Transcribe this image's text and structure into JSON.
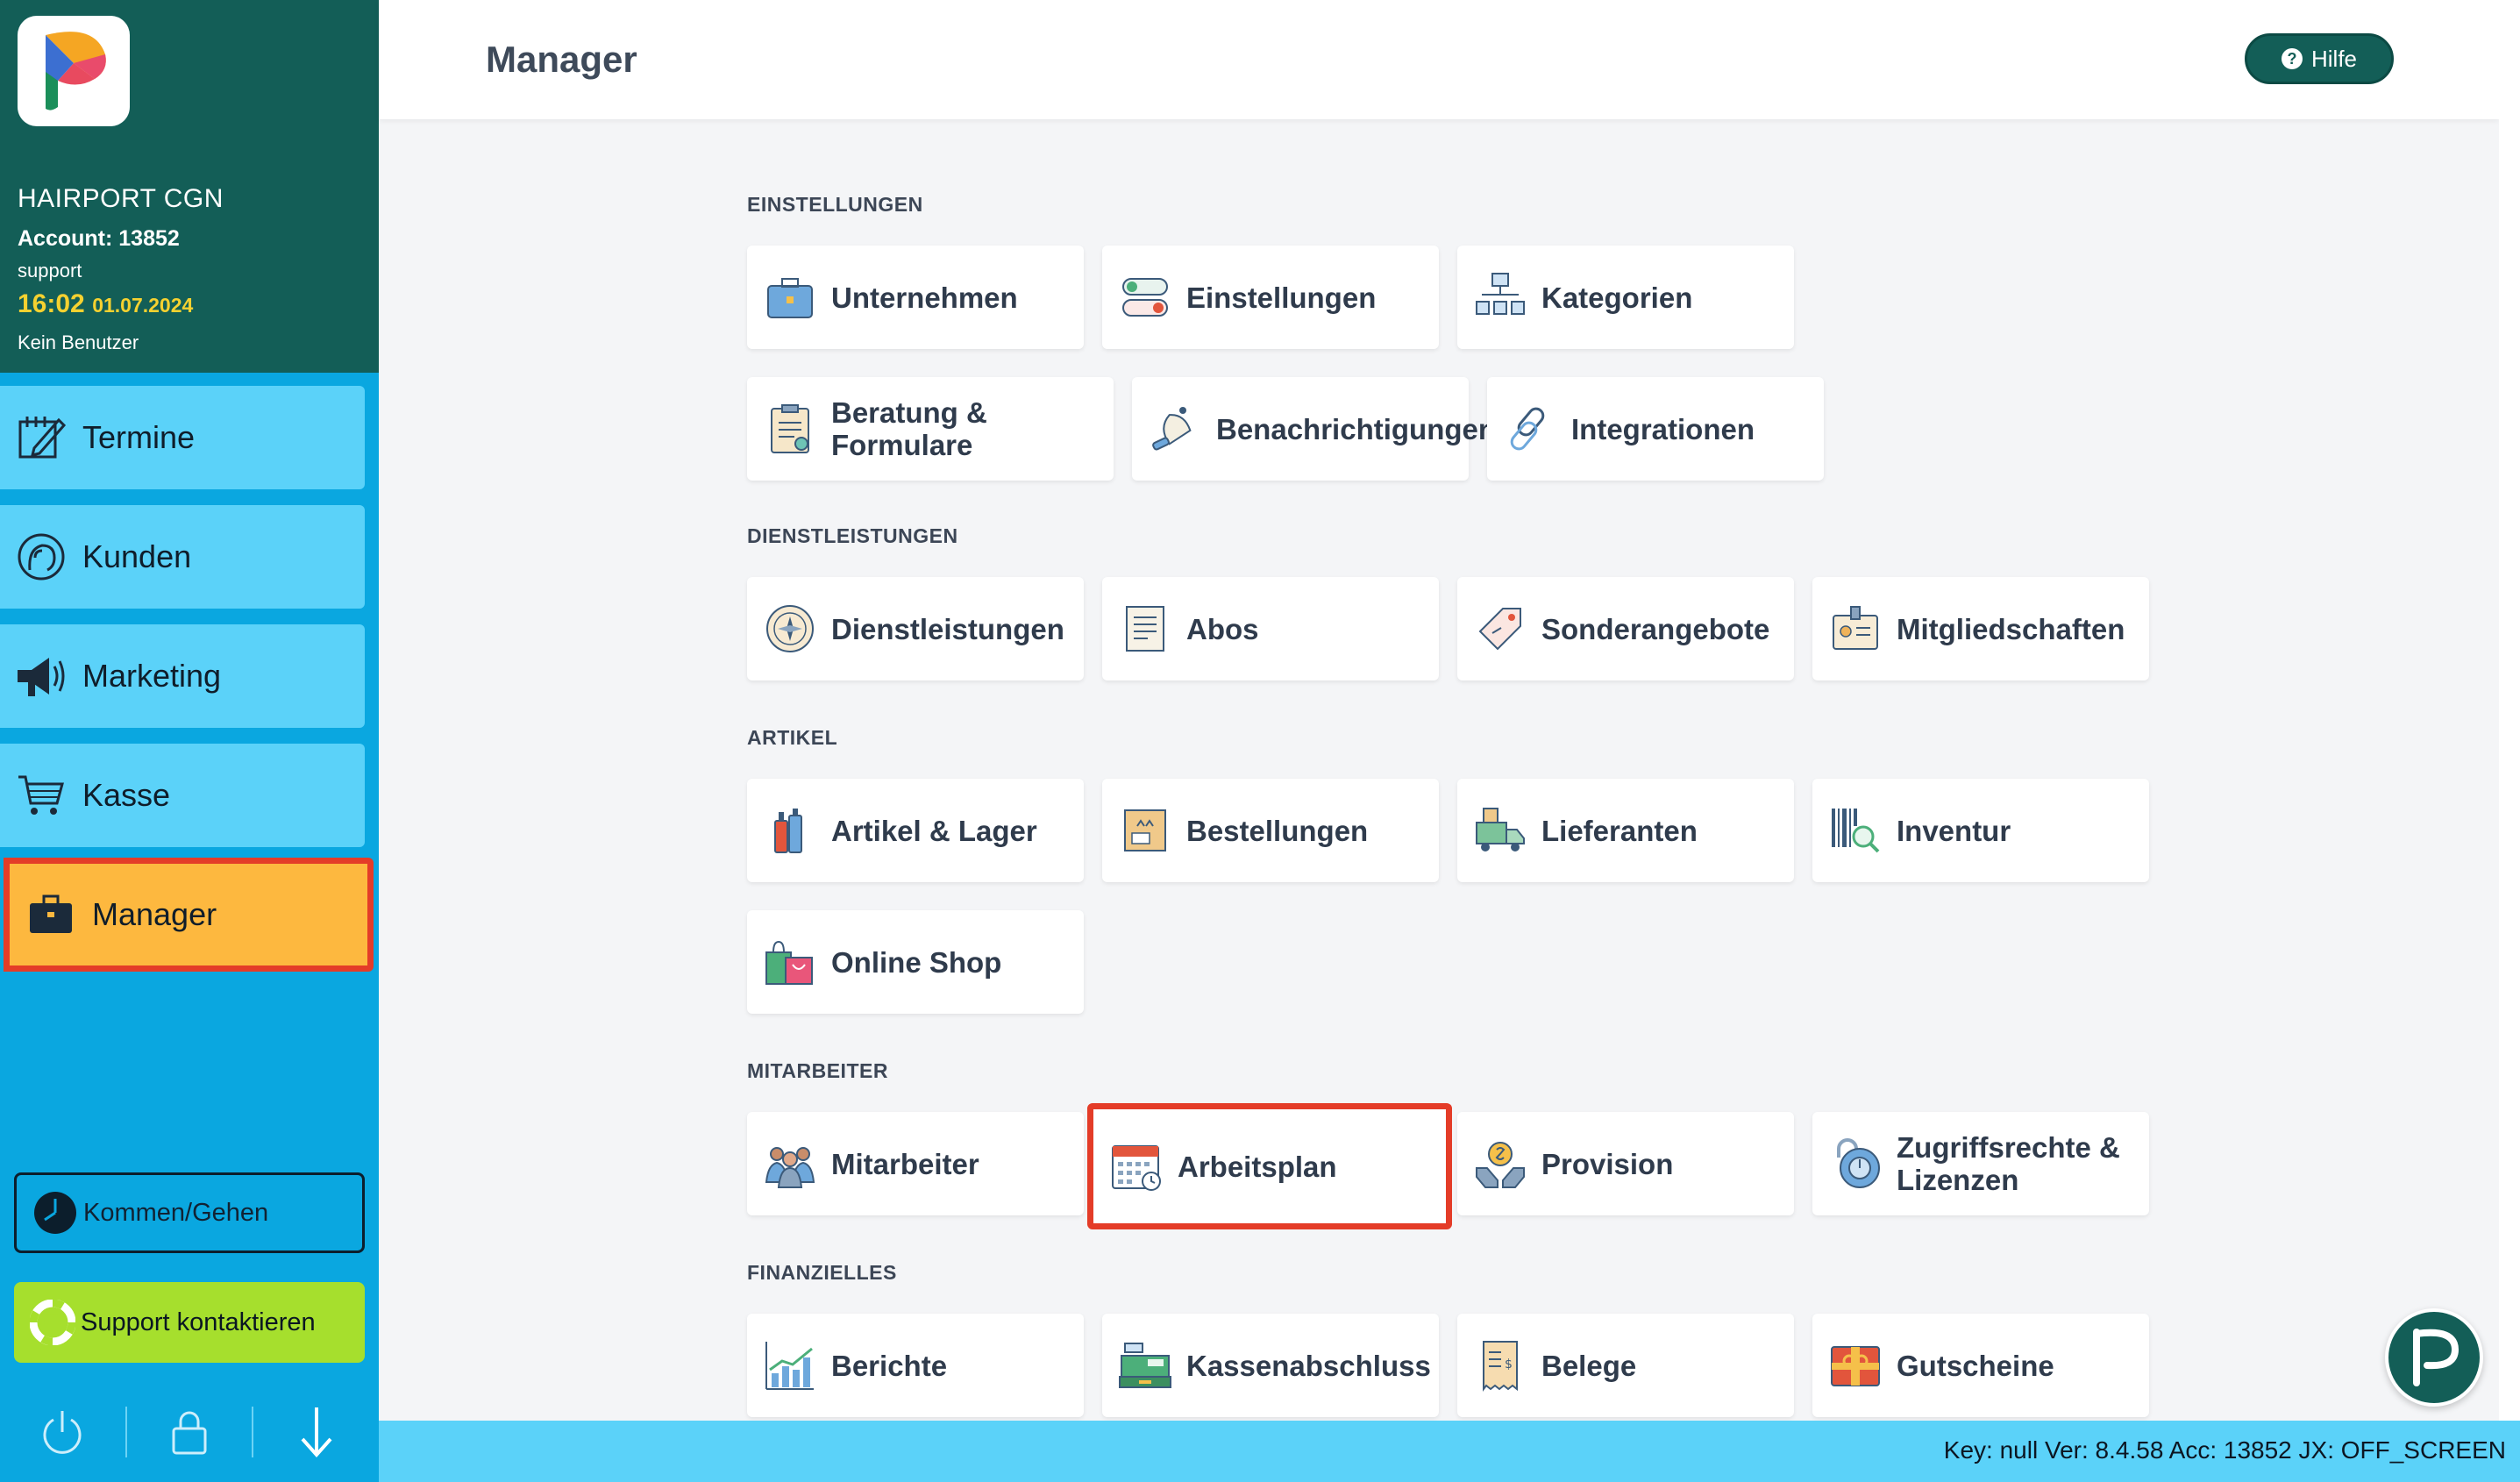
{
  "sidebar": {
    "business_name": "HAIRPORT CGN",
    "account": "Account: 13852",
    "role": "support",
    "time": "16:02",
    "date": "01.07.2024",
    "user": "Kein Benutzer",
    "nav": [
      {
        "label": "Termine",
        "icon": "calendar-pen-icon"
      },
      {
        "label": "Kunden",
        "icon": "customer-head-icon"
      },
      {
        "label": "Marketing",
        "icon": "megaphone-icon"
      },
      {
        "label": "Kasse",
        "icon": "shopping-cart-icon"
      },
      {
        "label": "Manager",
        "icon": "briefcase-icon",
        "active": true
      }
    ],
    "kommen_label": "Kommen/Gehen",
    "support_label": "Support kontaktieren"
  },
  "header": {
    "title": "Manager",
    "help_label": "Hilfe"
  },
  "sections": {
    "einstellungen": {
      "heading": "EINSTELLUNGEN",
      "tiles": [
        "Unternehmen",
        "Einstellungen",
        "Kategorien",
        "Beratung & Formulare",
        "Benachrichtigungen",
        "Integrationen"
      ]
    },
    "dienstleistungen": {
      "heading": "DIENSTLEISTUNGEN",
      "tiles": [
        "Dienstleistungen",
        "Abos",
        "Sonderangebote",
        "Mitgliedschaften"
      ]
    },
    "artikel": {
      "heading": "ARTIKEL",
      "tiles": [
        "Artikel & Lager",
        "Bestellungen",
        "Lieferanten",
        "Inventur",
        "Online Shop"
      ]
    },
    "mitarbeiter": {
      "heading": "MITARBEITER",
      "tiles": [
        "Mitarbeiter",
        "Arbeitsplan",
        "Provision",
        "Zugriffsrechte & Lizenzen"
      ]
    },
    "finanzielles": {
      "heading": "FINANZIELLES",
      "tiles": [
        "Berichte",
        "Kassenabschluss",
        "Belege",
        "Gutscheine"
      ]
    }
  },
  "status_bar": {
    "text": "Key: null Ver: 8.4.58 Acc: 13852  JX: OFF_SCREEN"
  },
  "colors": {
    "sidebar_header": "#135e57",
    "sidebar_bg": "#0aa7e0",
    "nav_item": "#5bd2f9",
    "nav_active": "#fdb83f",
    "highlight_border": "#e43c28",
    "support_button": "#a6df2d"
  }
}
